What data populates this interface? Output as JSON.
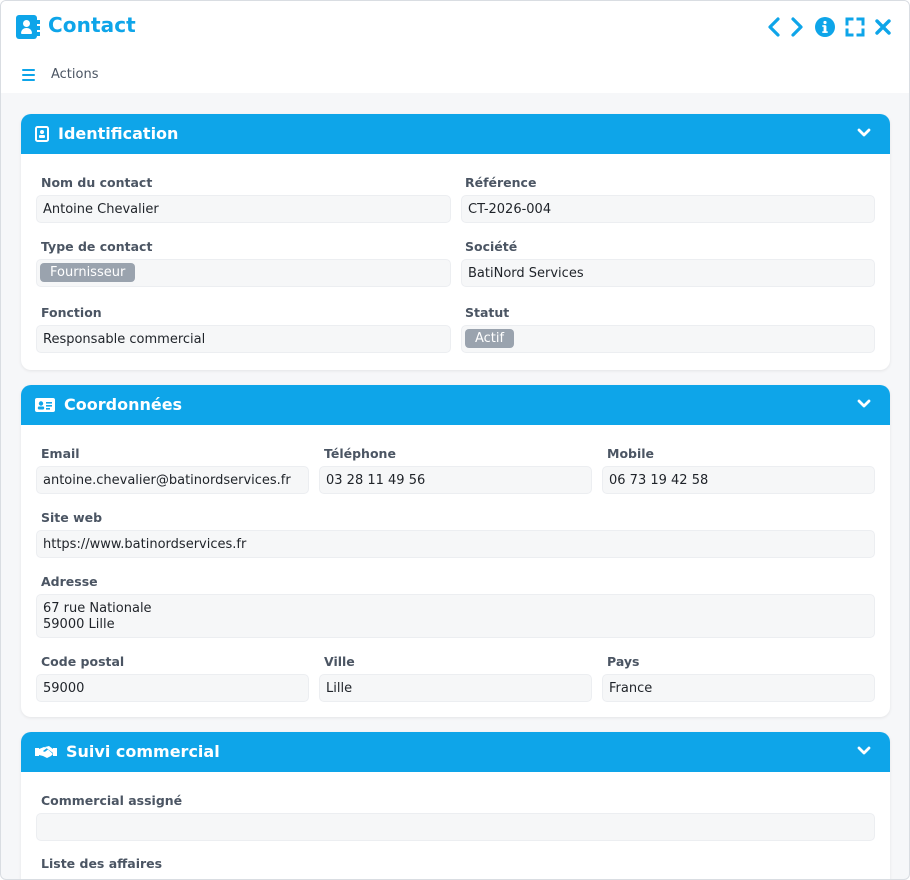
{
  "header": {
    "title": "Contact",
    "actions_label": "Actions"
  },
  "colors": {
    "accent": "#0ea5e9",
    "tag": "#9aa3ae"
  },
  "icons": {
    "title": "contact-book-icon",
    "prev": "chevron-left-icon",
    "next": "chevron-right-icon",
    "info": "info-icon",
    "fullscreen": "fullscreen-icon",
    "close": "close-icon",
    "menu": "hamburger-icon"
  },
  "identification": {
    "title": "Identification",
    "nom_label": "Nom du contact",
    "nom_value": "Antoine Chevalier",
    "ref_label": "Référence",
    "ref_value": "CT-2026-004",
    "type_label": "Type de contact",
    "type_value": "Fournisseur",
    "societe_label": "Société",
    "societe_value": "BatiNord Services",
    "fonction_label": "Fonction",
    "fonction_value": "Responsable commercial",
    "statut_label": "Statut",
    "statut_value": "Actif"
  },
  "coordonnees": {
    "title": "Coordonnées",
    "email_label": "Email",
    "email_value": "antoine.chevalier@batinordservices.fr",
    "tel_label": "Téléphone",
    "tel_value": "03 28 11 49 56",
    "mobile_label": "Mobile",
    "mobile_value": "06 73 19 42 58",
    "site_label": "Site web",
    "site_value": "https://www.batinordservices.fr",
    "adresse_label": "Adresse",
    "adresse_line1": "67 rue Nationale",
    "adresse_line2": "59000 Lille",
    "cp_label": "Code postal",
    "cp_value": "59000",
    "ville_label": "Ville",
    "ville_value": "Lille",
    "pays_label": "Pays",
    "pays_value": "France"
  },
  "suivi": {
    "title": "Suivi commercial",
    "commercial_label": "Commercial assigné",
    "commercial_value": "",
    "affaires_label": "Liste des affaires"
  }
}
